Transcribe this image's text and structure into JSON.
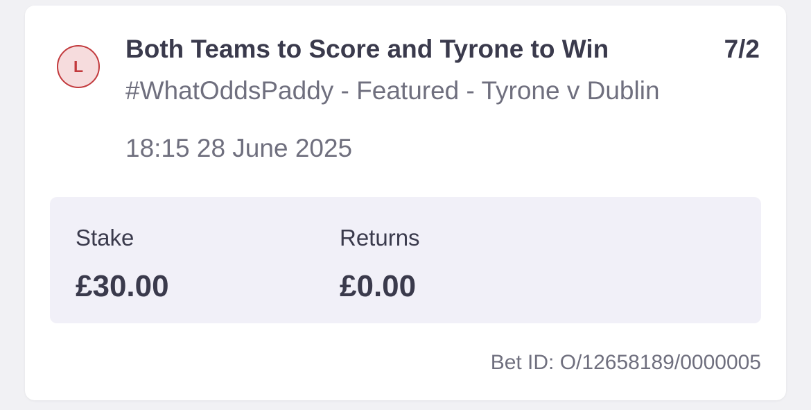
{
  "bet": {
    "status_letter": "L",
    "selection": "Both Teams to Score and Tyrone to Win",
    "odds": "7/2",
    "event": "#WhatOddsPaddy - Featured - Tyrone v Dublin",
    "datetime": "18:15 28 June 2025"
  },
  "summary": {
    "stake_label": "Stake",
    "stake_value": "£30.00",
    "returns_label": "Returns",
    "returns_value": "£0.00"
  },
  "footer": {
    "bet_id": "Bet ID: O/12658189/0000005"
  },
  "colors": {
    "lost_badge": "#c2393c",
    "lost_badge_bg": "#f6dcdd",
    "summary_bg": "#f1f0f8",
    "text_primary": "#3a3a4c",
    "text_secondary": "#6f6f7e"
  }
}
